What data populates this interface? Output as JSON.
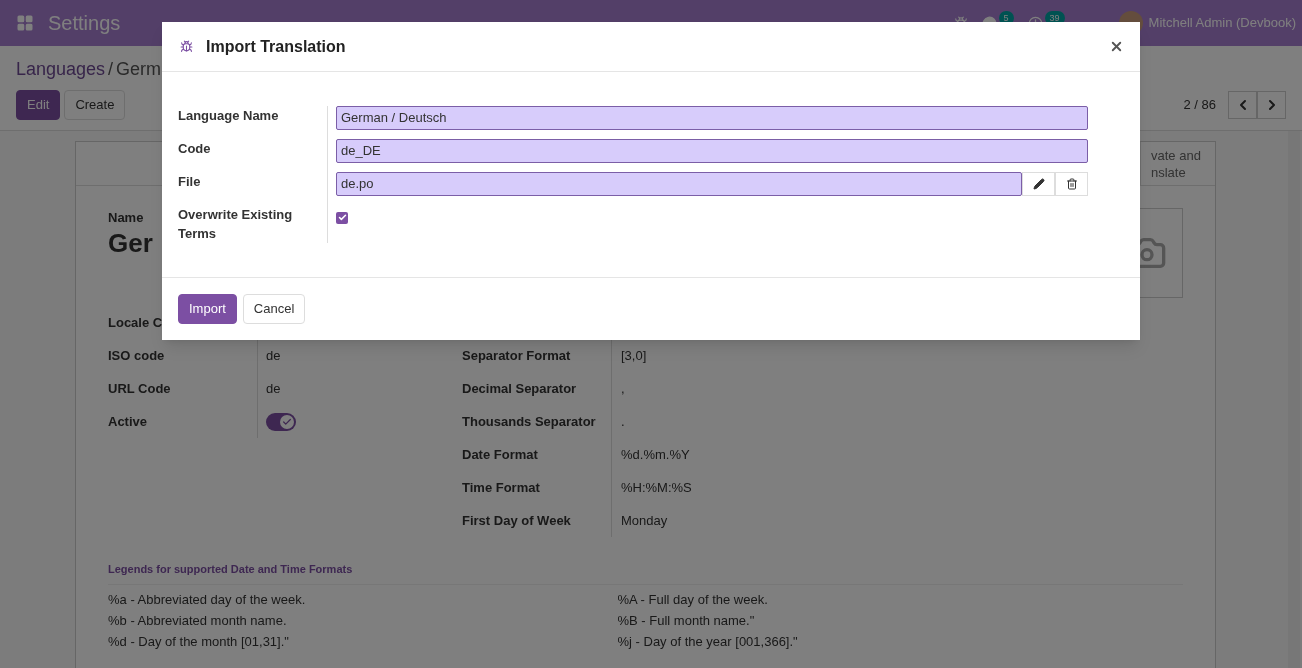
{
  "navbar": {
    "app_title": "Settings",
    "chat_badge": "5",
    "activity_badge": "39",
    "user": "Mitchell Admin (Devbook)"
  },
  "breadcrumb": [
    "Languages",
    "Germ"
  ],
  "breadcrumb_separator": "/",
  "buttons": [
    {
      "label": "Edit",
      "kind": "primary"
    },
    {
      "label": "Create",
      "kind": "secondary"
    }
  ],
  "pager": "2 / 86",
  "sheet": {
    "button_box": "vate and\nnslate",
    "name_label": "Name",
    "title": "Ger",
    "left_fields": [
      {
        "label": "Locale C",
        "kind": "text"
      },
      {
        "label": "ISO code",
        "kind": "text",
        "value": "de"
      },
      {
        "label": "URL Code",
        "kind": "text",
        "value": "de"
      },
      {
        "label": "Active",
        "kind": "toggle",
        "on": true
      }
    ],
    "right_fields": [
      {
        "label": "Separator Format",
        "value": "[3,0]"
      },
      {
        "label": "Decimal Separator",
        "value": ","
      },
      {
        "label": "Thousands Separator",
        "value": "."
      },
      {
        "label": "Date Format",
        "value": "%d.%m.%Y"
      },
      {
        "label": "Time Format",
        "value": "%H:%M:%S"
      },
      {
        "label": "First Day of Week",
        "value": "Monday"
      }
    ],
    "legend_title": "Legends for supported Date and Time Formats",
    "legend_left": [
      "%a - Abbreviated day of the week.",
      "%b - Abbreviated month name.",
      "%d - Day of the month [01,31].\""
    ],
    "legend_right": [
      "%A - Full day of the week.",
      "%B - Full month name.\"",
      "%j - Day of the year [001,366].\""
    ]
  },
  "dialog": {
    "title": "Import Translation",
    "fields": [
      {
        "label": "Language Name",
        "kind": "text",
        "value": "German / Deutsch"
      },
      {
        "label": "Code",
        "kind": "text",
        "value": "de_DE"
      },
      {
        "label": "File",
        "kind": "file",
        "value": "de.po"
      },
      {
        "label": "Overwrite Existing Terms",
        "kind": "checkbox",
        "checked": true
      }
    ],
    "actions": [
      {
        "label": "Import",
        "kind": "primary"
      },
      {
        "label": "Cancel",
        "kind": "secondary"
      }
    ]
  }
}
